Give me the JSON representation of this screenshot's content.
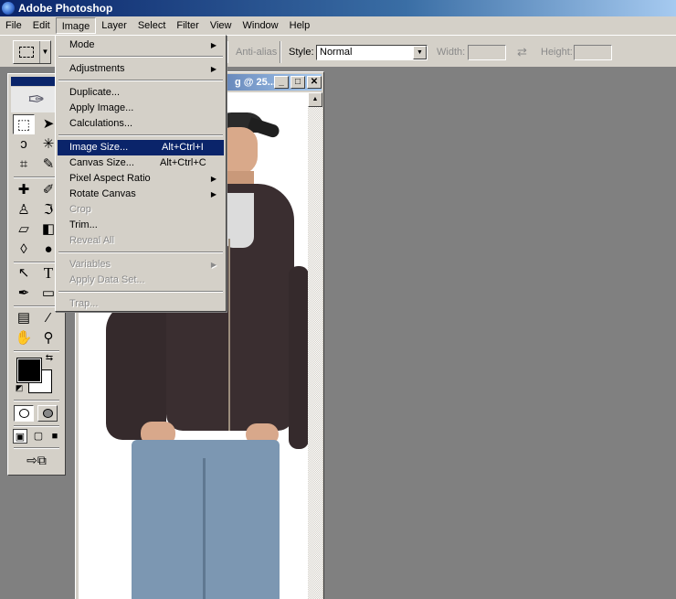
{
  "app": {
    "title": "Adobe Photoshop"
  },
  "menubar": {
    "items": [
      "File",
      "Edit",
      "Image",
      "Layer",
      "Select",
      "Filter",
      "View",
      "Window",
      "Help"
    ],
    "active": "Image"
  },
  "options": {
    "antialias": "Anti-alias",
    "style_label": "Style:",
    "style_value": "Normal",
    "width_label": "Width:",
    "height_label": "Height:",
    "swap_glyph": "⇄"
  },
  "document": {
    "title": "g @ 25..."
  },
  "image_menu": {
    "items": [
      {
        "label": "Mode",
        "submenu": true,
        "enabled": true
      },
      {
        "label": "Adjustments",
        "submenu": true,
        "enabled": true
      },
      {
        "label": "Duplicate...",
        "enabled": true
      },
      {
        "label": "Apply Image...",
        "enabled": true
      },
      {
        "label": "Calculations...",
        "enabled": true
      },
      {
        "label": "Image Size...",
        "shortcut": "Alt+Ctrl+I",
        "enabled": true,
        "highlighted": true
      },
      {
        "label": "Canvas Size...",
        "shortcut": "Alt+Ctrl+C",
        "enabled": true
      },
      {
        "label": "Pixel Aspect Ratio",
        "submenu": true,
        "enabled": true
      },
      {
        "label": "Rotate Canvas",
        "submenu": true,
        "enabled": true
      },
      {
        "label": "Crop",
        "enabled": false
      },
      {
        "label": "Trim...",
        "enabled": true
      },
      {
        "label": "Reveal All",
        "enabled": false
      },
      {
        "label": "Variables",
        "submenu": true,
        "enabled": false
      },
      {
        "label": "Apply Data Set...",
        "enabled": false
      },
      {
        "label": "Trap...",
        "enabled": false
      }
    ]
  },
  "toolbox": {
    "tools": [
      "rectangular-marquee",
      "move",
      "lasso",
      "magic-wand",
      "crop",
      "slice",
      "healing-brush",
      "brush",
      "clone-stamp",
      "history-brush",
      "eraser",
      "gradient",
      "blur",
      "dodge",
      "path-selection",
      "type",
      "pen",
      "shape",
      "notes",
      "eyedropper",
      "hand",
      "zoom"
    ],
    "glyphs": [
      "⬚",
      "➤",
      "ↄ",
      "✳",
      "⌗",
      "✎",
      "✚",
      "✐",
      "♙",
      "ℑ",
      "▱",
      "◧",
      "◊",
      "●",
      "↖",
      "T",
      "✒",
      "▭",
      "▤",
      "⁄",
      "✋",
      "⚲"
    ],
    "foreground_color": "#000000",
    "background_color": "#ffffff"
  }
}
